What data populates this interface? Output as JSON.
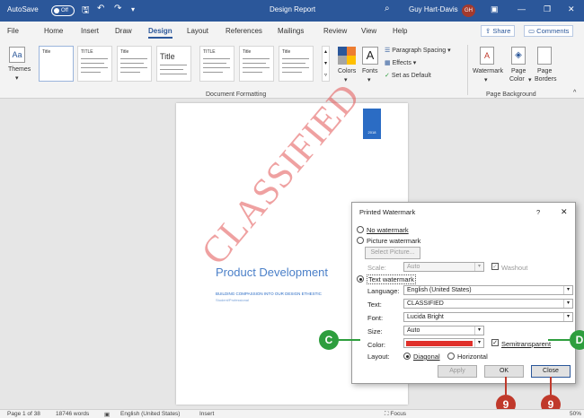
{
  "titlebar": {
    "autosave": "AutoSave",
    "toggle": "Off",
    "doc_title": "Design Report",
    "user": "Guy Hart-Davis",
    "initials": "GH",
    "accent": "#2b579a"
  },
  "menu": {
    "tabs": [
      "File",
      "Home",
      "Insert",
      "Draw",
      "Design",
      "Layout",
      "References",
      "Mailings",
      "Review",
      "View",
      "Help"
    ],
    "active": "Design",
    "share": "Share",
    "comments": "Comments"
  },
  "ribbon": {
    "themes": "Themes",
    "gallery": [
      "Title",
      "TITLE",
      "Title",
      "Title",
      "TITLE",
      "Title",
      "Title"
    ],
    "gallery_big_title": "Title",
    "colors": "Colors",
    "fonts": "Fonts",
    "paragraph_spacing": "Paragraph Spacing",
    "effects": "Effects",
    "set_as_default": "Set as Default",
    "watermark": "Watermark",
    "page_color": [
      "Page",
      "Color"
    ],
    "page_borders": [
      "Page",
      "Borders"
    ],
    "group_document_formatting": "Document Formatting",
    "group_page_background": "Page Background"
  },
  "document": {
    "title": "Product Development",
    "subtitle": "BUILDING COMPASSION INTO OUR DESIGN ETHESTIC",
    "subtitle2": "Student/Professional",
    "cover_badge": "2018",
    "watermark_text": "CLASSIFIED",
    "watermark_color": "#e25454"
  },
  "dialog": {
    "title": "Printed Watermark",
    "help": "?",
    "close": "✕",
    "no_watermark": "No watermark",
    "picture_watermark": "Picture watermark",
    "select_picture": "Select Picture...",
    "scale_label": "Scale:",
    "scale_value": "Auto",
    "washout": "Washout",
    "text_watermark": "Text watermark",
    "language_label": "Language:",
    "language_value": "English (United States)",
    "text_label": "Text:",
    "text_value": "CLASSIFIED",
    "font_label": "Font:",
    "font_value": "Lucida Bright",
    "size_label": "Size:",
    "size_value": "Auto",
    "color_label": "Color:",
    "color_value": "#e0302a",
    "semitransparent": "Semitransparent",
    "layout_label": "Layout:",
    "diagonal": "Diagonal",
    "horizontal": "Horizontal",
    "apply": "Apply",
    "ok": "OK",
    "cancel": "Close"
  },
  "callouts": {
    "c": "C",
    "d": "D",
    "n1": "9",
    "n2": "9"
  },
  "status": {
    "page": "Page 1 of 38",
    "words": "18746 words",
    "language": "English (United States)",
    "mode": "Insert",
    "focus": "Focus",
    "zoom": "50%"
  }
}
